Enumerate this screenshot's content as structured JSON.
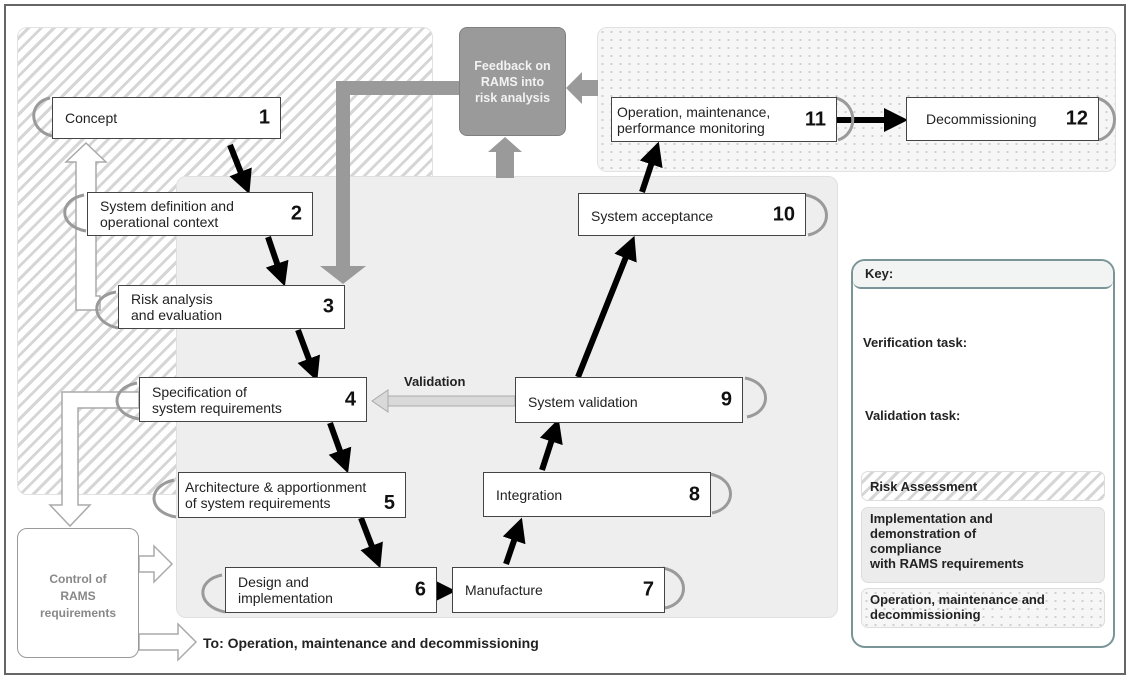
{
  "phases": [
    {
      "id": 1,
      "label": "Concept",
      "number": "1"
    },
    {
      "id": 2,
      "label": "System definition and\noperational context",
      "number": "2"
    },
    {
      "id": 3,
      "label": "Risk analysis\nand evaluation",
      "number": "3"
    },
    {
      "id": 4,
      "label": "Specification of\nsystem requirements",
      "number": "4"
    },
    {
      "id": 5,
      "label": "Architecture & apportionment\nof system requirements",
      "number": "5"
    },
    {
      "id": 6,
      "label": "Design and\nimplementation",
      "number": "6"
    },
    {
      "id": 7,
      "label": "Manufacture",
      "number": "7"
    },
    {
      "id": 8,
      "label": "Integration",
      "number": "8"
    },
    {
      "id": 9,
      "label": "System validation",
      "number": "9"
    },
    {
      "id": 10,
      "label": "System acceptance",
      "number": "10"
    },
    {
      "id": 11,
      "label": "Operation, maintenance,\nperformance monitoring",
      "number": "11"
    },
    {
      "id": 12,
      "label": "Decommissioning",
      "number": "12"
    }
  ],
  "feedback": {
    "label": "Feedback on\nRAMS into\nrisk analysis"
  },
  "control": {
    "label": "Control of\nRAMS\nrequirements"
  },
  "validation_arrow_label": "Validation",
  "to_ops_label": "To: Operation, maintenance and decommissioning",
  "key": {
    "title": "Key:",
    "verification": "Verification task:",
    "validation": "Validation task:",
    "zones": {
      "risk": "Risk Assessment",
      "impl": "Implementation and\ndemonstration of\ncompliance\nwith RAMS requirements",
      "ops": "Operation, maintenance and\ndecommissioning"
    }
  },
  "colors": {
    "flow_arrow": "#000000",
    "feedback_gray": "#9a9a9a",
    "validation_arrow": "#d9d9d9",
    "key_border": "#7a9598"
  }
}
